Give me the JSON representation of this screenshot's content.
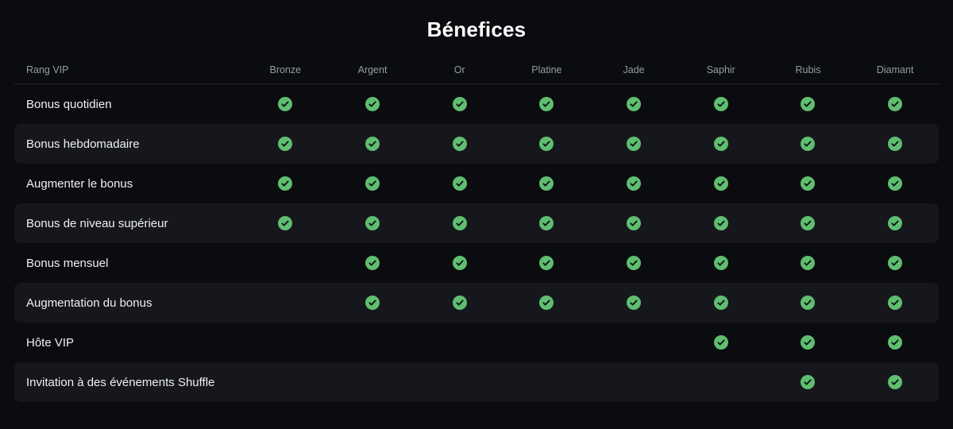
{
  "title": "Bénefices",
  "table": {
    "rank_header": "Rang VIP",
    "columns": [
      "Bronze",
      "Argent",
      "Or",
      "Platine",
      "Jade",
      "Saphir",
      "Rubis",
      "Diamant"
    ],
    "rows": [
      {
        "label": "Bonus quotidien",
        "checks": [
          true,
          true,
          true,
          true,
          true,
          true,
          true,
          true
        ]
      },
      {
        "label": "Bonus hebdomadaire",
        "checks": [
          true,
          true,
          true,
          true,
          true,
          true,
          true,
          true
        ]
      },
      {
        "label": "Augmenter le bonus",
        "checks": [
          true,
          true,
          true,
          true,
          true,
          true,
          true,
          true
        ]
      },
      {
        "label": "Bonus de niveau supérieur",
        "checks": [
          true,
          true,
          true,
          true,
          true,
          true,
          true,
          true
        ]
      },
      {
        "label": "Bonus mensuel",
        "checks": [
          false,
          true,
          true,
          true,
          true,
          true,
          true,
          true
        ]
      },
      {
        "label": "Augmentation du bonus",
        "checks": [
          false,
          true,
          true,
          true,
          true,
          true,
          true,
          true
        ]
      },
      {
        "label": "Hôte VIP",
        "checks": [
          false,
          false,
          false,
          false,
          false,
          true,
          true,
          true
        ]
      },
      {
        "label": "Invitation à des événements Shuffle",
        "checks": [
          false,
          false,
          false,
          false,
          false,
          false,
          true,
          true
        ]
      }
    ]
  },
  "colors": {
    "page_bg": "#0a0c0f",
    "stripe_bg": "#15171c",
    "divider": "#25272c",
    "header_text": "#969ca4",
    "label_text": "#eef0f2",
    "check_green": "#5fbe6f",
    "check_mark": "#0e1116"
  },
  "icons": {
    "check": "check-circle-icon"
  }
}
